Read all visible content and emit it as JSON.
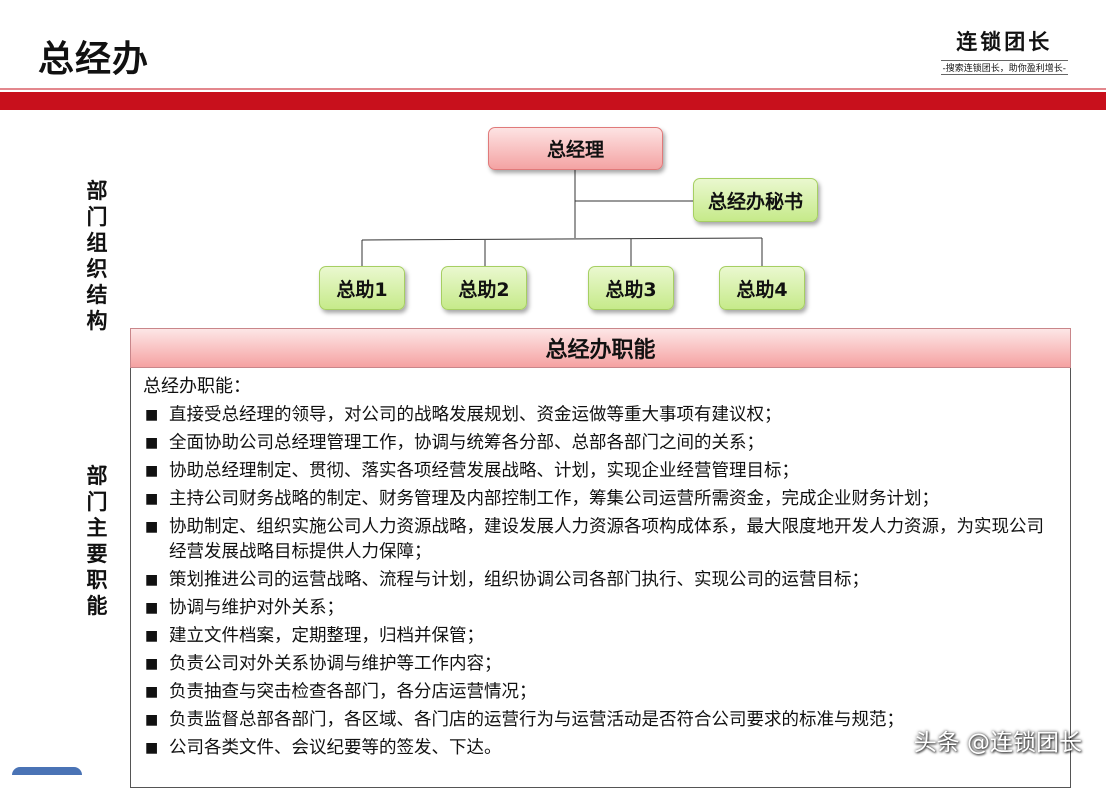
{
  "header": {
    "title": "总经办",
    "logo_main": "连锁团长",
    "logo_sub": "-搜索连锁团长，助你盈利增长-"
  },
  "side_labels": {
    "structure": [
      "部",
      "门",
      "组",
      "织",
      "结",
      "构"
    ],
    "functions": [
      "部",
      "门",
      "主",
      "要",
      "职",
      "能"
    ]
  },
  "org_chart": {
    "root": "总经理",
    "secretary": "总经办秘书",
    "assistants": [
      "总助1",
      "总助2",
      "总助3",
      "总助4"
    ]
  },
  "functions": {
    "header": "总经办职能",
    "intro": "总经办职能：",
    "bullet_glyph": "■",
    "items": [
      "直接受总经理的领导，对公司的战略发展规划、资金运做等重大事项有建议权；",
      "全面协助公司总经理管理工作，协调与统筹各分部、总部各部门之间的关系；",
      "协助总经理制定、贯彻、落实各项经营发展战略、计划，实现企业经营管理目标；",
      "主持公司财务战略的制定、财务管理及内部控制工作，筹集公司运营所需资金，完成企业财务计划；",
      "协助制定、组织实施公司人力资源战略，建设发展人力资源各项构成体系，最大限度地开发人力资源，为实现公司经营发展战略目标提供人力保障；",
      "策划推进公司的运营战略、流程与计划，组织协调公司各部门执行、实现公司的运营目标；",
      "协调与维护对外关系；",
      "建立文件档案，定期整理，归档并保管；",
      "负责公司对外关系协调与维护等工作内容；",
      "负责抽查与突击检查各部门，各分店运营情况；",
      "负责监督总部各部门，各区域、各门店的运营行为与运营活动是否符合公司要求的标准与规范；",
      "公司各类文件、会议纪要等的签发、下达。"
    ]
  },
  "watermark": "头条 @连锁团长",
  "colors": {
    "band_red": "#c8101c",
    "node_red": "#f4a3a3",
    "node_green": "#c6ea8a"
  }
}
